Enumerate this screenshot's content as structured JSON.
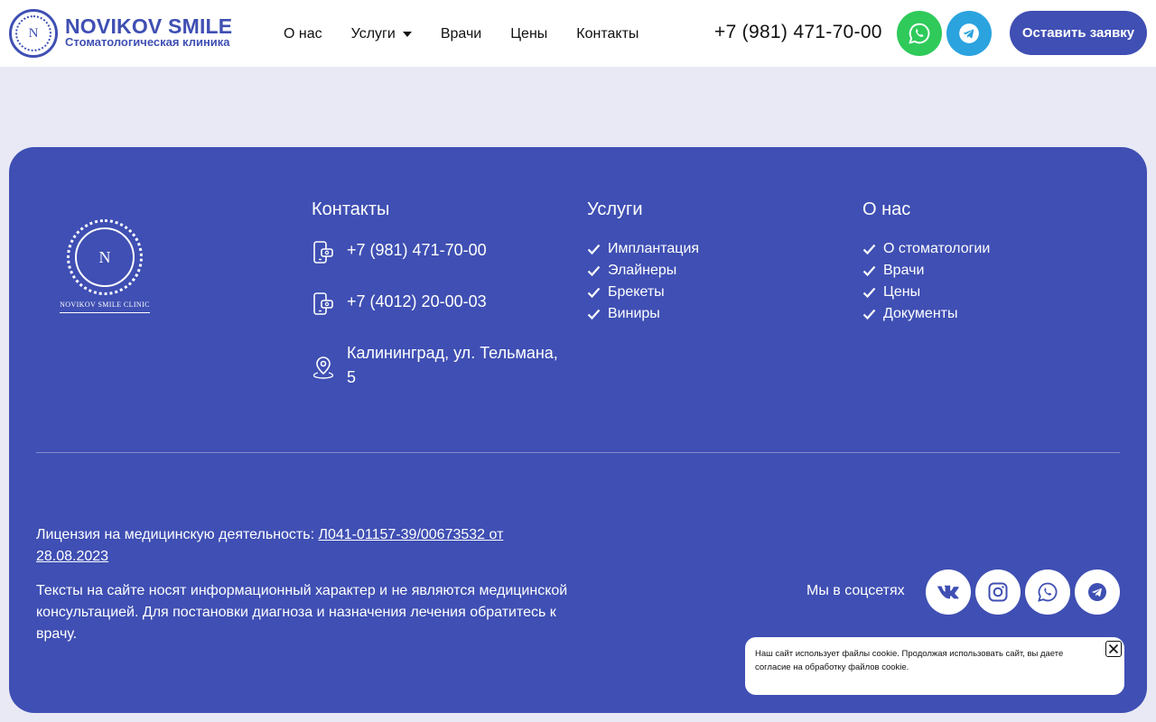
{
  "header": {
    "brand_title": "NOVIKOV SMILE",
    "brand_subtitle": "Стоматологическая клиника",
    "logo_letter": "N",
    "nav": [
      {
        "label": "О нас"
      },
      {
        "label": "Услуги",
        "has_dropdown": true
      },
      {
        "label": "Врачи"
      },
      {
        "label": "Цены"
      },
      {
        "label": "Контакты"
      }
    ],
    "phone": "+7 (981) 471-70-00",
    "cta_label": "Оставить заявку",
    "whatsapp_icon": "whatsapp-icon",
    "telegram_icon": "telegram-icon"
  },
  "footer": {
    "logo_letter": "N",
    "logo_caption": "NOVIKOV SMILE CLINIC",
    "contacts": {
      "title": "Контакты",
      "items": [
        {
          "icon": "phone-icon",
          "text": "+7 (981) 471-70-00"
        },
        {
          "icon": "phone-icon",
          "text": "+7 (4012) 20-00-03"
        },
        {
          "icon": "location-pin-icon",
          "text": "Калининград, ул. Тельмана, 5"
        }
      ]
    },
    "services": {
      "title": "Услуги",
      "items": [
        "Имплантация",
        "Элайнеры",
        "Брекеты",
        "Виниры"
      ]
    },
    "about": {
      "title": "О нас",
      "items": [
        "О стоматологии",
        "Врачи",
        "Цены",
        "Документы"
      ]
    },
    "license_prefix": "Лицензия на медицинскую деятельность: ",
    "license_link": "Л041-01157-39/00673532 от 28.08.2023",
    "disclaimer": "Тексты на сайте носят информационный характер и не являются медицинской консультацией. Для постановки диагноза и назначения лечения обратитесь к врачу.",
    "social_label": "Мы в соцсетях",
    "social_icons": [
      "vk-icon",
      "instagram-icon",
      "whatsapp-icon",
      "telegram-icon"
    ]
  },
  "cookie": {
    "message": "Наш сайт использует файлы cookie. Продолжая использовать сайт, вы даете согласие на обработку файлов cookie."
  },
  "colors": {
    "brand_blue": "#3f4fb3",
    "page_bg": "#e8e9f4",
    "whatsapp_green": "#2fca5a",
    "telegram_blue": "#2aa3df"
  }
}
